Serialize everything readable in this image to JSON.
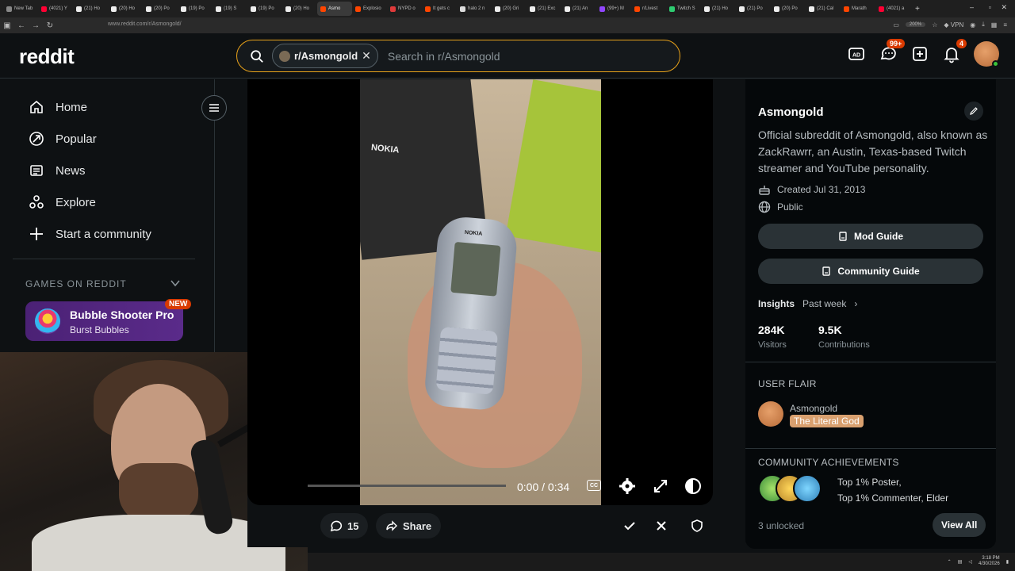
{
  "browser": {
    "tabs": [
      {
        "label": "New Tab",
        "color": "#888888"
      },
      {
        "label": "(4021) Y",
        "color": "#ff0033"
      },
      {
        "label": "(21) Ho",
        "color": "#eeeeee"
      },
      {
        "label": "(20) Ho",
        "color": "#eeeeee"
      },
      {
        "label": "(20) Po",
        "color": "#eeeeee"
      },
      {
        "label": "(19) Po",
        "color": "#eeeeee"
      },
      {
        "label": "(19) S",
        "color": "#eeeeee"
      },
      {
        "label": "(19) Po",
        "color": "#eeeeee"
      },
      {
        "label": "(20) Ho",
        "color": "#eeeeee"
      },
      {
        "label": "Asmo",
        "color": "#ff4500",
        "active": true
      },
      {
        "label": "Explosio",
        "color": "#ff4500"
      },
      {
        "label": "NYPD o",
        "color": "#e03a3a"
      },
      {
        "label": "It gets c",
        "color": "#ff4500"
      },
      {
        "label": "halo 2 n",
        "color": "#dddddd"
      },
      {
        "label": "(20) Gri",
        "color": "#eeeeee"
      },
      {
        "label": "(21) Exc",
        "color": "#eeeeee"
      },
      {
        "label": "(21) An",
        "color": "#eeeeee"
      },
      {
        "label": "(99+) M",
        "color": "#9146ff"
      },
      {
        "label": "r/Livest",
        "color": "#ff4500"
      },
      {
        "label": "Twitch S",
        "color": "#2ecc71"
      },
      {
        "label": "(21) Ho",
        "color": "#eeeeee"
      },
      {
        "label": "(21) Po",
        "color": "#eeeeee"
      },
      {
        "label": "(20) Po",
        "color": "#eeeeee"
      },
      {
        "label": "(21) Cal",
        "color": "#eeeeee"
      },
      {
        "label": "Marath",
        "color": "#ff4500"
      },
      {
        "label": "(4021) a",
        "color": "#ff0033"
      }
    ],
    "url": "www.reddit.com/r/Asmongold/",
    "zoom": "200%",
    "vpn_label": "VPN"
  },
  "header": {
    "logo": "reddit",
    "search_chip": "r/Asmongold",
    "search_placeholder": "Search in r/Asmongold",
    "chat_badge": "99+",
    "notif_badge": "4"
  },
  "left_nav": {
    "items": [
      {
        "label": "Home",
        "icon": "home-icon"
      },
      {
        "label": "Popular",
        "icon": "popular-icon"
      },
      {
        "label": "News",
        "icon": "news-icon"
      },
      {
        "label": "Explore",
        "icon": "explore-icon"
      },
      {
        "label": "Start a community",
        "icon": "plus-icon"
      }
    ],
    "games_header": "GAMES ON REDDIT",
    "game": {
      "title": "Bubble Shooter Pro",
      "subtitle": "Burst Bubbles",
      "badge": "NEW"
    }
  },
  "video": {
    "box_label": "NOKIA",
    "phone_brand": "NOKIA",
    "time": "0:00 / 0:34",
    "cc_label": "CC",
    "progress_fraction": 0.0
  },
  "post_actions": {
    "comments": "15",
    "share": "Share"
  },
  "sidebar": {
    "title": "Asmongold",
    "description": "Official subreddit of Asmongold, also known as ZackRawrr, an Austin, Texas-based Twitch streamer and YouTube personality.",
    "created": "Created Jul 31, 2013",
    "visibility": "Public",
    "mod_guide": "Mod Guide",
    "community_guide": "Community Guide",
    "insights_label": "Insights",
    "insights_period": "Past week",
    "stats": [
      {
        "value": "284K",
        "label": "Visitors"
      },
      {
        "value": "9.5K",
        "label": "Contributions"
      }
    ],
    "user_flair_header": "USER FLAIR",
    "flair_user": "Asmongold",
    "flair_tag": "The Literal God",
    "achievements_header": "COMMUNITY ACHIEVEMENTS",
    "achievements_line1": "Top 1% Poster,",
    "achievements_line2": "Top 1% Commenter, Elder",
    "unlocked": "3 unlocked",
    "view_all": "View All"
  },
  "taskbar": {
    "time": "3:18 PM",
    "date": "4/30/2026"
  },
  "colors": {
    "accent_search_border": "#e8a21a",
    "badge": "#d93a00",
    "game_card": "#4b2175",
    "flair_tag": "#d9a06f"
  }
}
